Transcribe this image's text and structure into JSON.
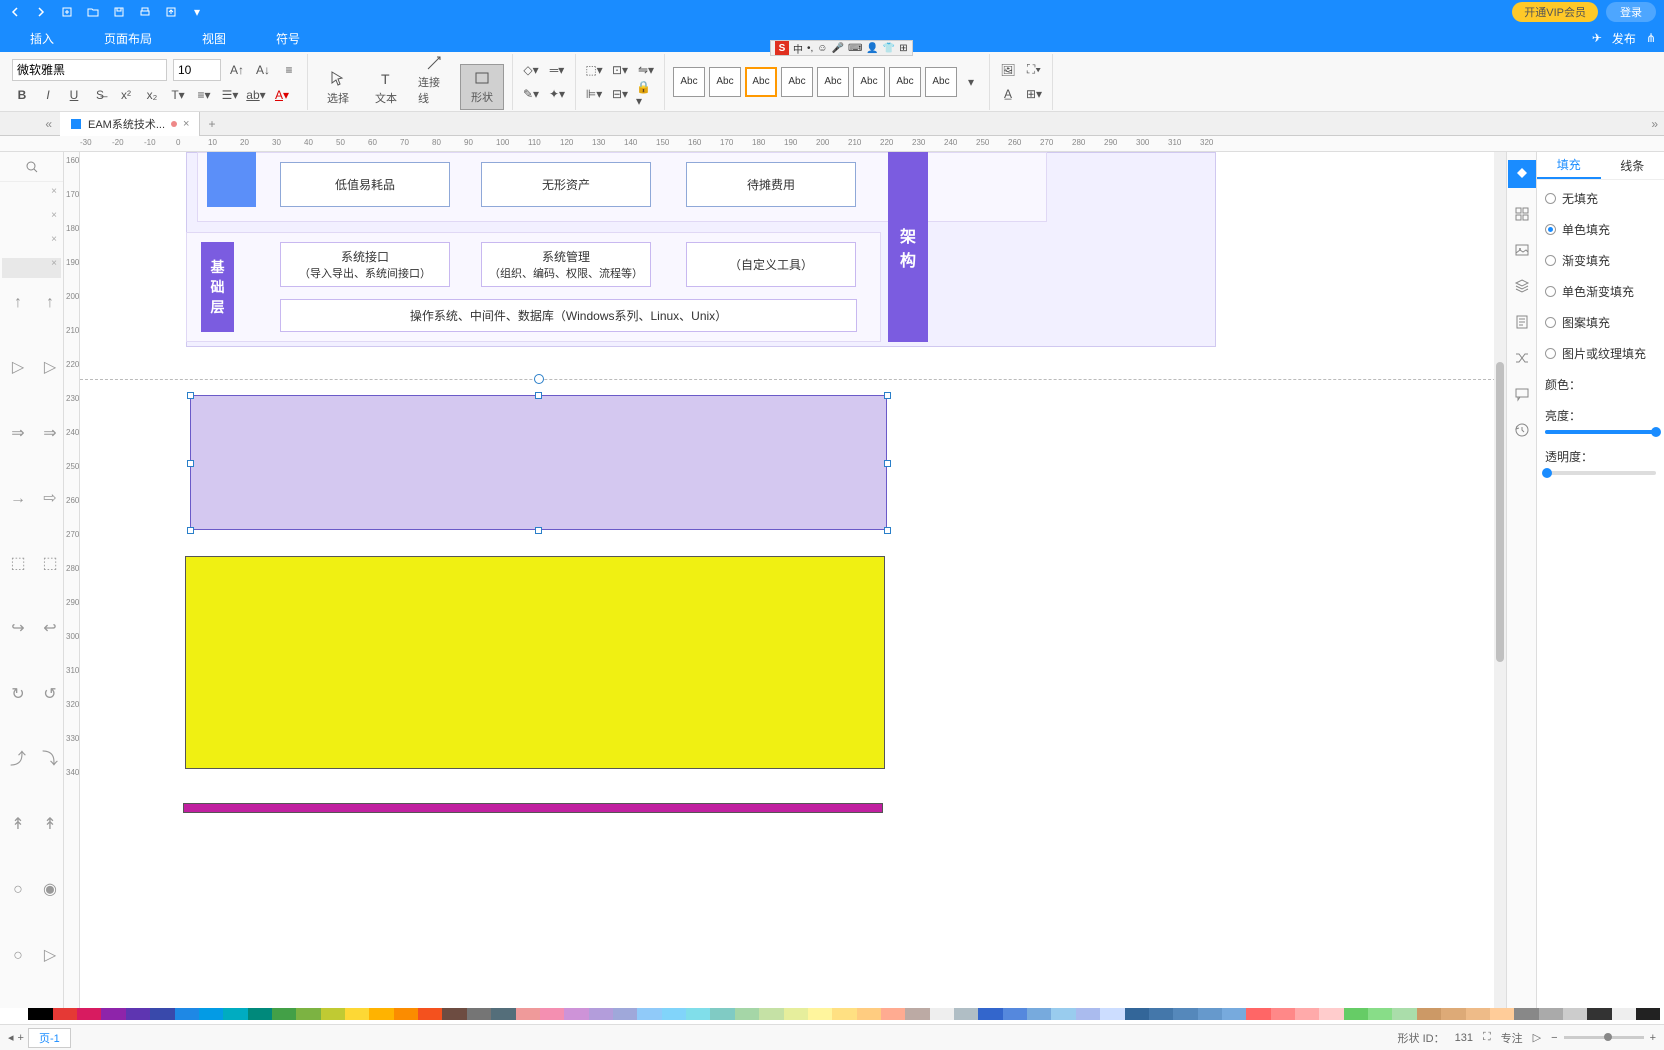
{
  "titlebar": {
    "vip": "开通VIP会员",
    "login": "登录",
    "publish": "发布"
  },
  "menubar": {
    "insert": "插入",
    "layout": "页面布局",
    "view": "视图",
    "symbol": "符号"
  },
  "ribbon": {
    "font": "微软雅黑",
    "size": "10",
    "tools": {
      "select": "选择",
      "text": "文本",
      "connector": "连接线",
      "shape": "形状"
    },
    "style_label": "Abc"
  },
  "tab": {
    "name": "EAM系统技术..."
  },
  "ime": {
    "lang": "中"
  },
  "ruler_h": [
    -30,
    -20,
    -10,
    0,
    10,
    20,
    30,
    40,
    50,
    60,
    70,
    80,
    90,
    100,
    110,
    120,
    130,
    140,
    150,
    160,
    170,
    180,
    190,
    200,
    210,
    220,
    230,
    240,
    250,
    260,
    270,
    280,
    290,
    300,
    310,
    320
  ],
  "ruler_v": [
    160,
    170,
    180,
    190,
    200,
    210,
    220,
    230,
    240,
    250,
    260,
    270,
    280,
    290,
    300,
    310,
    320,
    330,
    340
  ],
  "canvas": {
    "box1": "低值易耗品",
    "box2": "无形资产",
    "box3": "待摊费用",
    "side_label_top": [
      "架",
      "构"
    ],
    "layer_label": [
      "基",
      "础",
      "层"
    ],
    "boxA_l1": "系统接口",
    "boxA_l2": "（导入导出、系统间接口）",
    "boxB_l1": "系统管理",
    "boxB_l2": "（组织、编码、权限、流程等）",
    "boxC": "（自定义工具）",
    "boxD": "操作系统、中间件、数据库（Windows系列、Linux、Unix）"
  },
  "props": {
    "tab_fill": "填充",
    "tab_line": "线条",
    "none": "无填充",
    "solid": "单色填充",
    "gradient": "渐变填充",
    "solid_gradient": "单色渐变填充",
    "pattern": "图案填充",
    "image": "图片或纹理填充",
    "color": "颜色：",
    "brightness": "亮度：",
    "opacity": "透明度："
  },
  "status": {
    "page": "页-1",
    "shape_id_label": "形状 ID：",
    "shape_id": "131",
    "focus": "专注"
  },
  "colors": [
    "#fff",
    "#000",
    "#e53935",
    "#d81b60",
    "#8e24aa",
    "#5e35b1",
    "#3949ab",
    "#1e88e5",
    "#039be5",
    "#00acc1",
    "#00897b",
    "#43a047",
    "#7cb342",
    "#c0ca33",
    "#fdd835",
    "#ffb300",
    "#fb8c00",
    "#f4511e",
    "#6d4c41",
    "#757575",
    "#546e7a",
    "#ef9a9a",
    "#f48fb1",
    "#ce93d8",
    "#b39ddb",
    "#9fa8da",
    "#90caf9",
    "#81d4fa",
    "#80deea",
    "#80cbc4",
    "#a5d6a7",
    "#c5e1a5",
    "#e6ee9c",
    "#fff59d",
    "#ffe082",
    "#ffcc80",
    "#ffab91",
    "#bcaaa4",
    "#eeeeee",
    "#b0bec5",
    "#3366cc",
    "#5588dd",
    "#77aadd",
    "#99ccee",
    "#aabbee",
    "#ccddff",
    "#336699",
    "#4477aa",
    "#5588bb",
    "#6699cc",
    "#77aadd",
    "#ff6666",
    "#ff8888",
    "#ffaaaa",
    "#ffcccc",
    "#66cc66",
    "#88dd88",
    "#aaddaa",
    "#cc9966",
    "#ddaa77",
    "#eebb88",
    "#ffcc99",
    "#888888",
    "#aaaaaa",
    "#cccccc",
    "#333333",
    "#eeeeee",
    "#222222"
  ]
}
